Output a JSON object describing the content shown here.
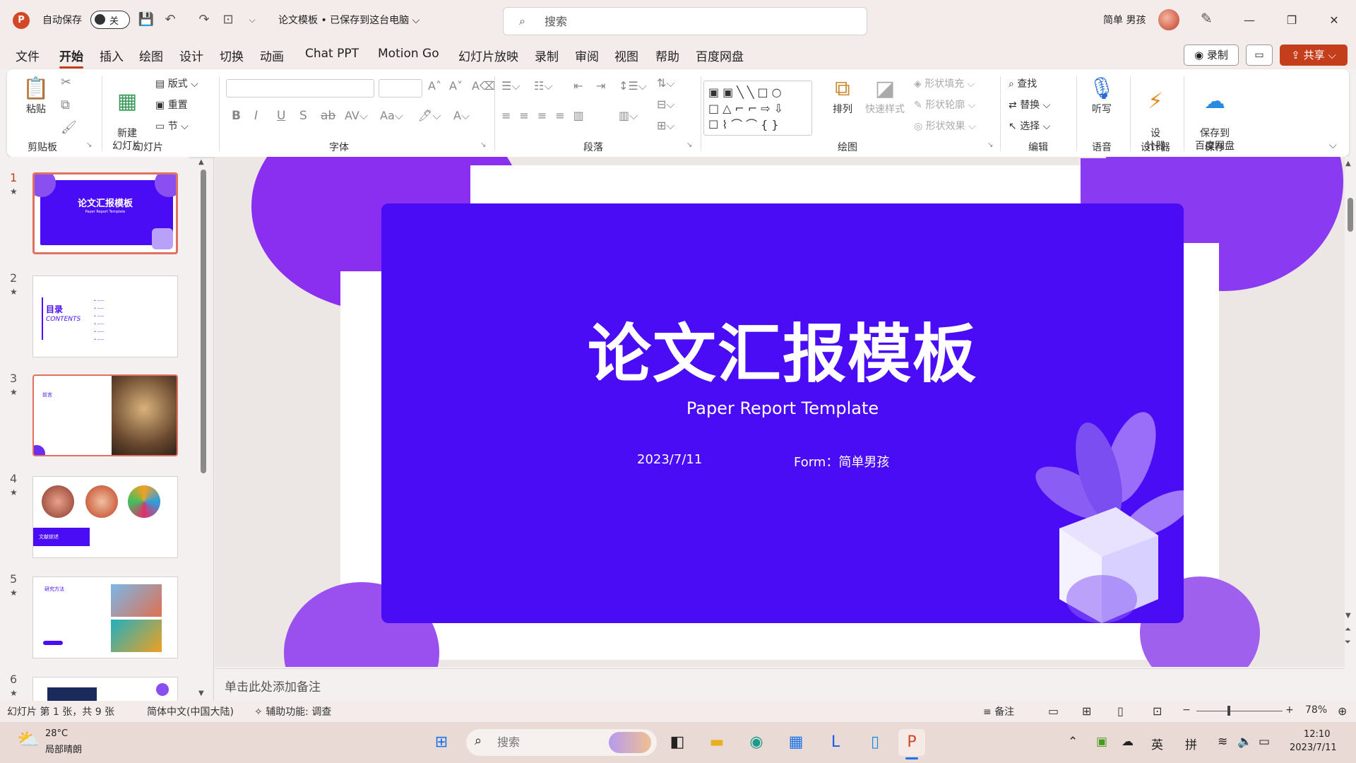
{
  "titlebar": {
    "app_logo": "P",
    "autosave_label": "自动保存",
    "autosave_state": "关",
    "doc_title": "论文模板 • 已保存到这台电脑 ⌵",
    "search_placeholder": "搜索",
    "user_name": "简单 男孩"
  },
  "tabs": [
    "文件",
    "开始",
    "插入",
    "绘图",
    "设计",
    "切换",
    "动画",
    "Chat PPT",
    "Motion Go",
    "幻灯片放映",
    "录制",
    "审阅",
    "视图",
    "帮助",
    "百度网盘"
  ],
  "tab_actions": {
    "record": "◉ 录制",
    "share": "⇪ 共享 ⌵"
  },
  "ribbon": {
    "groups": {
      "clipboard": "剪贴板",
      "slides": "幻灯片",
      "font": "字体",
      "paragraph": "段落",
      "drawing": "绘图",
      "editing": "编辑",
      "voice": "语音",
      "designer": "设计器",
      "save": "保存"
    },
    "paste": "粘贴",
    "new_slide": "新建\n幻灯片",
    "layout": "版式",
    "reset": "重置",
    "section": "节",
    "arrange": "排列",
    "quick_styles": "快速样式",
    "shape_fill": "形状填充",
    "shape_outline": "形状轮廓",
    "shape_effects": "形状效果",
    "find": "查找",
    "replace": "替换",
    "select": "选择",
    "dictate": "听写",
    "designer_btn": "设\n计器",
    "save_baidu": "保存到\n百度网盘"
  },
  "thumbnails": [
    {
      "num": "1",
      "title": "论文汇报模板",
      "sub": "Paper Report Template"
    },
    {
      "num": "2",
      "title": "目录",
      "sub": "CONTENTS"
    },
    {
      "num": "3",
      "title": "前言"
    },
    {
      "num": "4",
      "title": "文献综述"
    },
    {
      "num": "5",
      "title": "研究方法"
    },
    {
      "num": "6"
    }
  ],
  "slide": {
    "title": "论文汇报模板",
    "subtitle": "Paper Report Template",
    "date": "2023/7/11",
    "author": "Form：简单男孩",
    "colors": {
      "primary": "#4a0cf5",
      "accent": "#8a4ff0"
    }
  },
  "notes_placeholder": "单击此处添加备注",
  "status": {
    "slide_info": "幻灯片 第 1 张，共 9 张",
    "language": "简体中文(中国大陆)",
    "accessibility": "辅助功能: 调查",
    "notes": "备注",
    "zoom": "78%"
  },
  "taskbar": {
    "weather_temp": "28°C",
    "weather_desc": "局部晴朗",
    "search_placeholder": "搜索",
    "ime_lang": "英",
    "ime_mode": "拼",
    "time": "12:10",
    "date": "2023/7/11"
  }
}
